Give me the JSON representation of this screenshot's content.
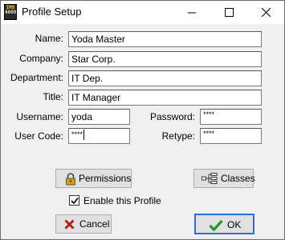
{
  "window": {
    "title": "Profile Setup",
    "icon_text_line1": "IMS",
    "icon_text_line2": "4000"
  },
  "form": {
    "name_label": "Name:",
    "name_value": "Yoda Master",
    "company_label": "Company:",
    "company_value": "Star Corp.",
    "department_label": "Department:",
    "department_value": "IT Dep.",
    "title_label": "Title:",
    "title_value": "IT Manager",
    "username_label": "Username:",
    "username_value": "yoda",
    "password_label": "Password:",
    "password_value": "****",
    "usercode_label": "User Code:",
    "usercode_value": "****",
    "retype_label": "Retype:",
    "retype_value": "****"
  },
  "buttons": {
    "permissions_label": "Permissions",
    "classes_label": "Classes",
    "cancel_label": "Cancel",
    "ok_label": "OK"
  },
  "options": {
    "enable_profile_label": "Enable this Profile",
    "enable_profile_checked": true
  },
  "colors": {
    "cancel_icon": "#b0201c",
    "ok_icon": "#1f9a2b",
    "default_button_border": "#2a6fd6"
  }
}
